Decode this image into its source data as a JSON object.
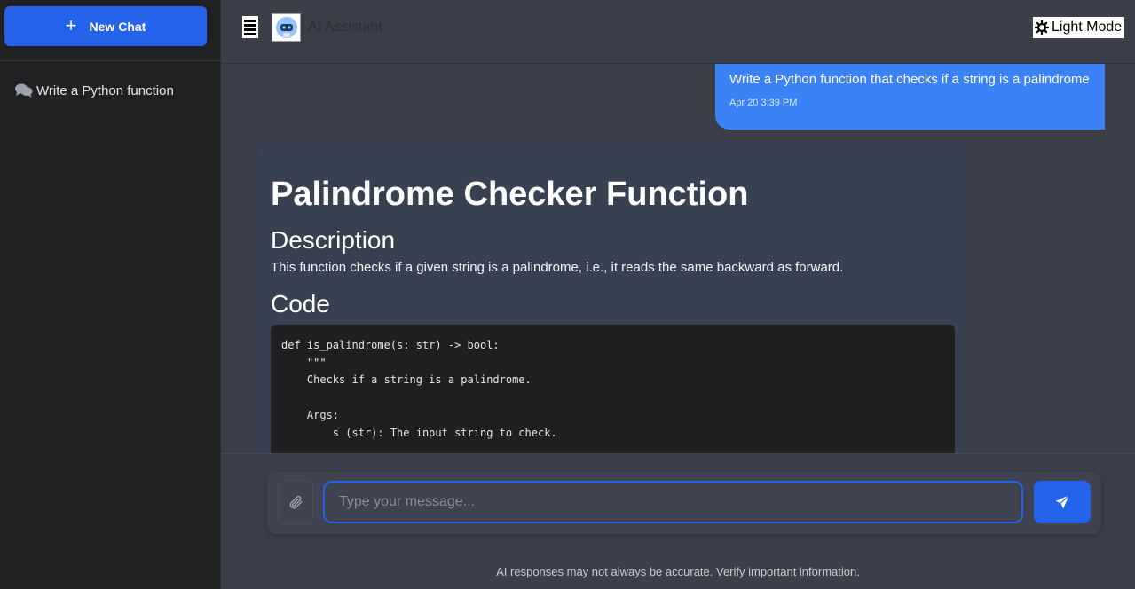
{
  "sidebar": {
    "new_chat_label": "New Chat",
    "history": [
      {
        "label": "Write a Python function"
      }
    ]
  },
  "header": {
    "title": "AI Assistant",
    "theme_toggle_label": "Light Mode"
  },
  "messages": {
    "user": {
      "text": "Write a Python function that checks if a string is a palindrome",
      "time": "Apr 20 3:39 PM"
    },
    "assistant": {
      "title": "Palindrome Checker Function",
      "description_heading": "Description",
      "description": "This function checks if a given string is a palindrome, i.e., it reads the same backward as forward.",
      "code_heading": "Code",
      "code": "def is_palindrome(s: str) -> bool:\n    \"\"\"\n    Checks if a string is a palindrome.\n\n    Args:\n        s (str): The input string to check."
    }
  },
  "composer": {
    "placeholder": "Type your message...",
    "value": ""
  },
  "footer": {
    "disclaimer": "AI responses may not always be accurate. Verify important information."
  },
  "colors": {
    "accent": "#2563eb",
    "user_bubble": "#3b82f6",
    "assistant_bubble": "#374151",
    "sidebar_bg": "#202123",
    "main_bg": "#3c3f4a"
  }
}
